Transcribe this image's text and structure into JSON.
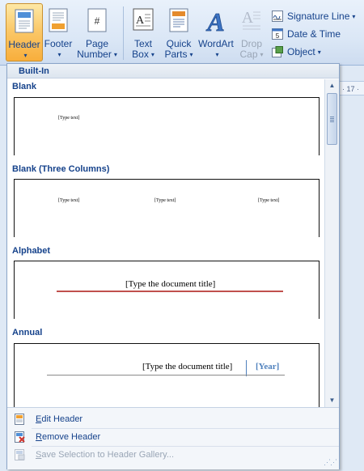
{
  "ribbon": {
    "buttons": [
      {
        "label": "Header",
        "icon": "header-icon",
        "has_dropdown": true,
        "active": true
      },
      {
        "label": "Footer",
        "icon": "footer-icon",
        "has_dropdown": true
      },
      {
        "label": "Page\nNumber",
        "icon": "page-number-icon",
        "has_dropdown": true
      },
      {
        "label": "Text\nBox",
        "icon": "text-box-icon",
        "has_dropdown": true
      },
      {
        "label": "Quick\nParts",
        "icon": "quick-parts-icon",
        "has_dropdown": true
      },
      {
        "label": "WordArt",
        "icon": "wordart-icon",
        "has_dropdown": true
      },
      {
        "label": "Drop\nCap",
        "icon": "drop-cap-icon",
        "has_dropdown": true,
        "disabled": true
      }
    ],
    "small_buttons": [
      {
        "label": "Signature Line",
        "icon": "signature-line-icon",
        "has_dropdown": true
      },
      {
        "label": "Date & Time",
        "icon": "date-time-icon"
      },
      {
        "label": "Object",
        "icon": "object-icon",
        "has_dropdown": true
      }
    ],
    "page_number_glyph": "#",
    "text_box_glyph": "A",
    "wordart_glyph": "A"
  },
  "ruler": {
    "text": "· 17 ·"
  },
  "gallery": {
    "section_header": "Built-In",
    "categories": [
      {
        "name": "Blank",
        "texts": [
          "[Type text]"
        ]
      },
      {
        "name": "Blank (Three Columns)",
        "texts": [
          "[Type text]",
          "[Type text]",
          "[Type text]"
        ]
      },
      {
        "name": "Alphabet",
        "texts": [
          "[Type the document title]"
        ]
      },
      {
        "name": "Annual",
        "texts": [
          "[Type the document title]",
          "[Year]"
        ]
      }
    ],
    "menu": [
      {
        "label": "Edit Header",
        "icon": "edit-header-icon",
        "disabled": false
      },
      {
        "label": "Remove Header",
        "icon": "remove-header-icon",
        "disabled": false
      },
      {
        "label": "Save Selection to Header Gallery...",
        "icon": "save-selection-icon",
        "disabled": true
      }
    ]
  },
  "colors": {
    "accent": "#15428b",
    "active": "#f8ae3c",
    "alphabet_rule": "#c0504d",
    "year": "#4f81bd"
  }
}
